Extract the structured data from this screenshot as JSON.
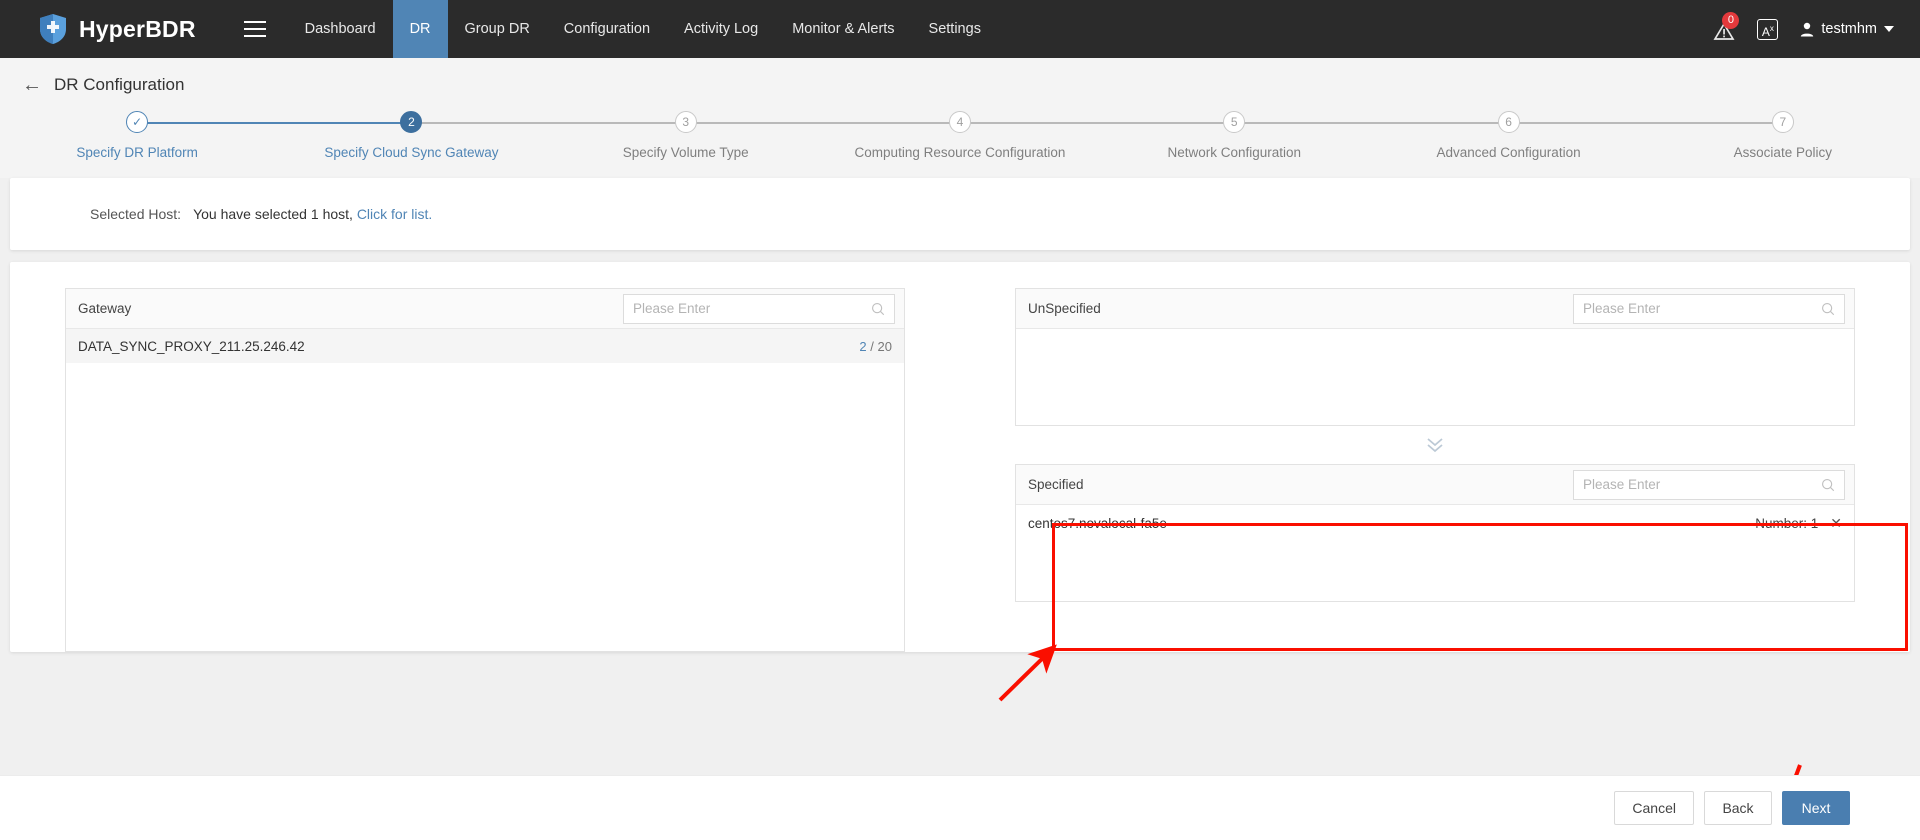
{
  "header": {
    "brand": "HyperBDR",
    "menu_icon": "hamburger-icon",
    "nav": [
      {
        "label": "Dashboard",
        "active": false
      },
      {
        "label": "DR",
        "active": true
      },
      {
        "label": "Group DR",
        "active": false
      },
      {
        "label": "Configuration",
        "active": false
      },
      {
        "label": "Activity Log",
        "active": false
      },
      {
        "label": "Monitor & Alerts",
        "active": false
      },
      {
        "label": "Settings",
        "active": false
      }
    ],
    "alert_badge": "0",
    "alert_icon": "warning-bell-icon",
    "translate_icon": "translate-icon",
    "translate_label": "A",
    "user_icon": "user-icon",
    "user_name": "testmhm"
  },
  "page": {
    "back_icon": "back-arrow-icon",
    "title": "DR Configuration"
  },
  "stepper": {
    "steps": [
      {
        "num": "✓",
        "label": "Specify DR Platform",
        "state": "done"
      },
      {
        "num": "2",
        "label": "Specify Cloud Sync Gateway",
        "state": "current"
      },
      {
        "num": "3",
        "label": "Specify Volume Type",
        "state": "todo"
      },
      {
        "num": "4",
        "label": "Computing Resource Configuration",
        "state": "todo"
      },
      {
        "num": "5",
        "label": "Network Configuration",
        "state": "todo"
      },
      {
        "num": "6",
        "label": "Advanced Configuration",
        "state": "todo"
      },
      {
        "num": "7",
        "label": "Associate Policy",
        "state": "todo"
      }
    ]
  },
  "selected_host": {
    "label": "Selected Host:",
    "text_before": "You have selected",
    "count": "1",
    "text_after": "host,",
    "link": "Click for list."
  },
  "gateway_panel": {
    "title": "Gateway",
    "search_placeholder": "Please Enter",
    "search_value": "",
    "search_icon": "search-icon",
    "rows": [
      {
        "name": "DATA_SYNC_PROXY_211.25.246.42",
        "used": "2",
        "separator": "/",
        "total": "20"
      }
    ]
  },
  "unspecified_panel": {
    "title": "UnSpecified",
    "search_placeholder": "Please Enter",
    "search_value": "",
    "search_icon": "search-icon",
    "rows": []
  },
  "transfer_control": {
    "icon": "double-chevron-down-icon"
  },
  "specified_panel": {
    "title": "Specified",
    "search_placeholder": "Please Enter",
    "search_value": "",
    "search_icon": "search-icon",
    "rows": [
      {
        "name": "centos7.novalocal-fa5e",
        "number_label": "Number: 1",
        "remove_icon": "close-icon"
      }
    ]
  },
  "footer": {
    "cancel": "Cancel",
    "back": "Back",
    "next": "Next"
  },
  "annotations": {
    "highlight_color": "#fa0f00",
    "arrow_to_specified": "arrow-annotation",
    "arrow_to_next": "arrow-annotation"
  }
}
